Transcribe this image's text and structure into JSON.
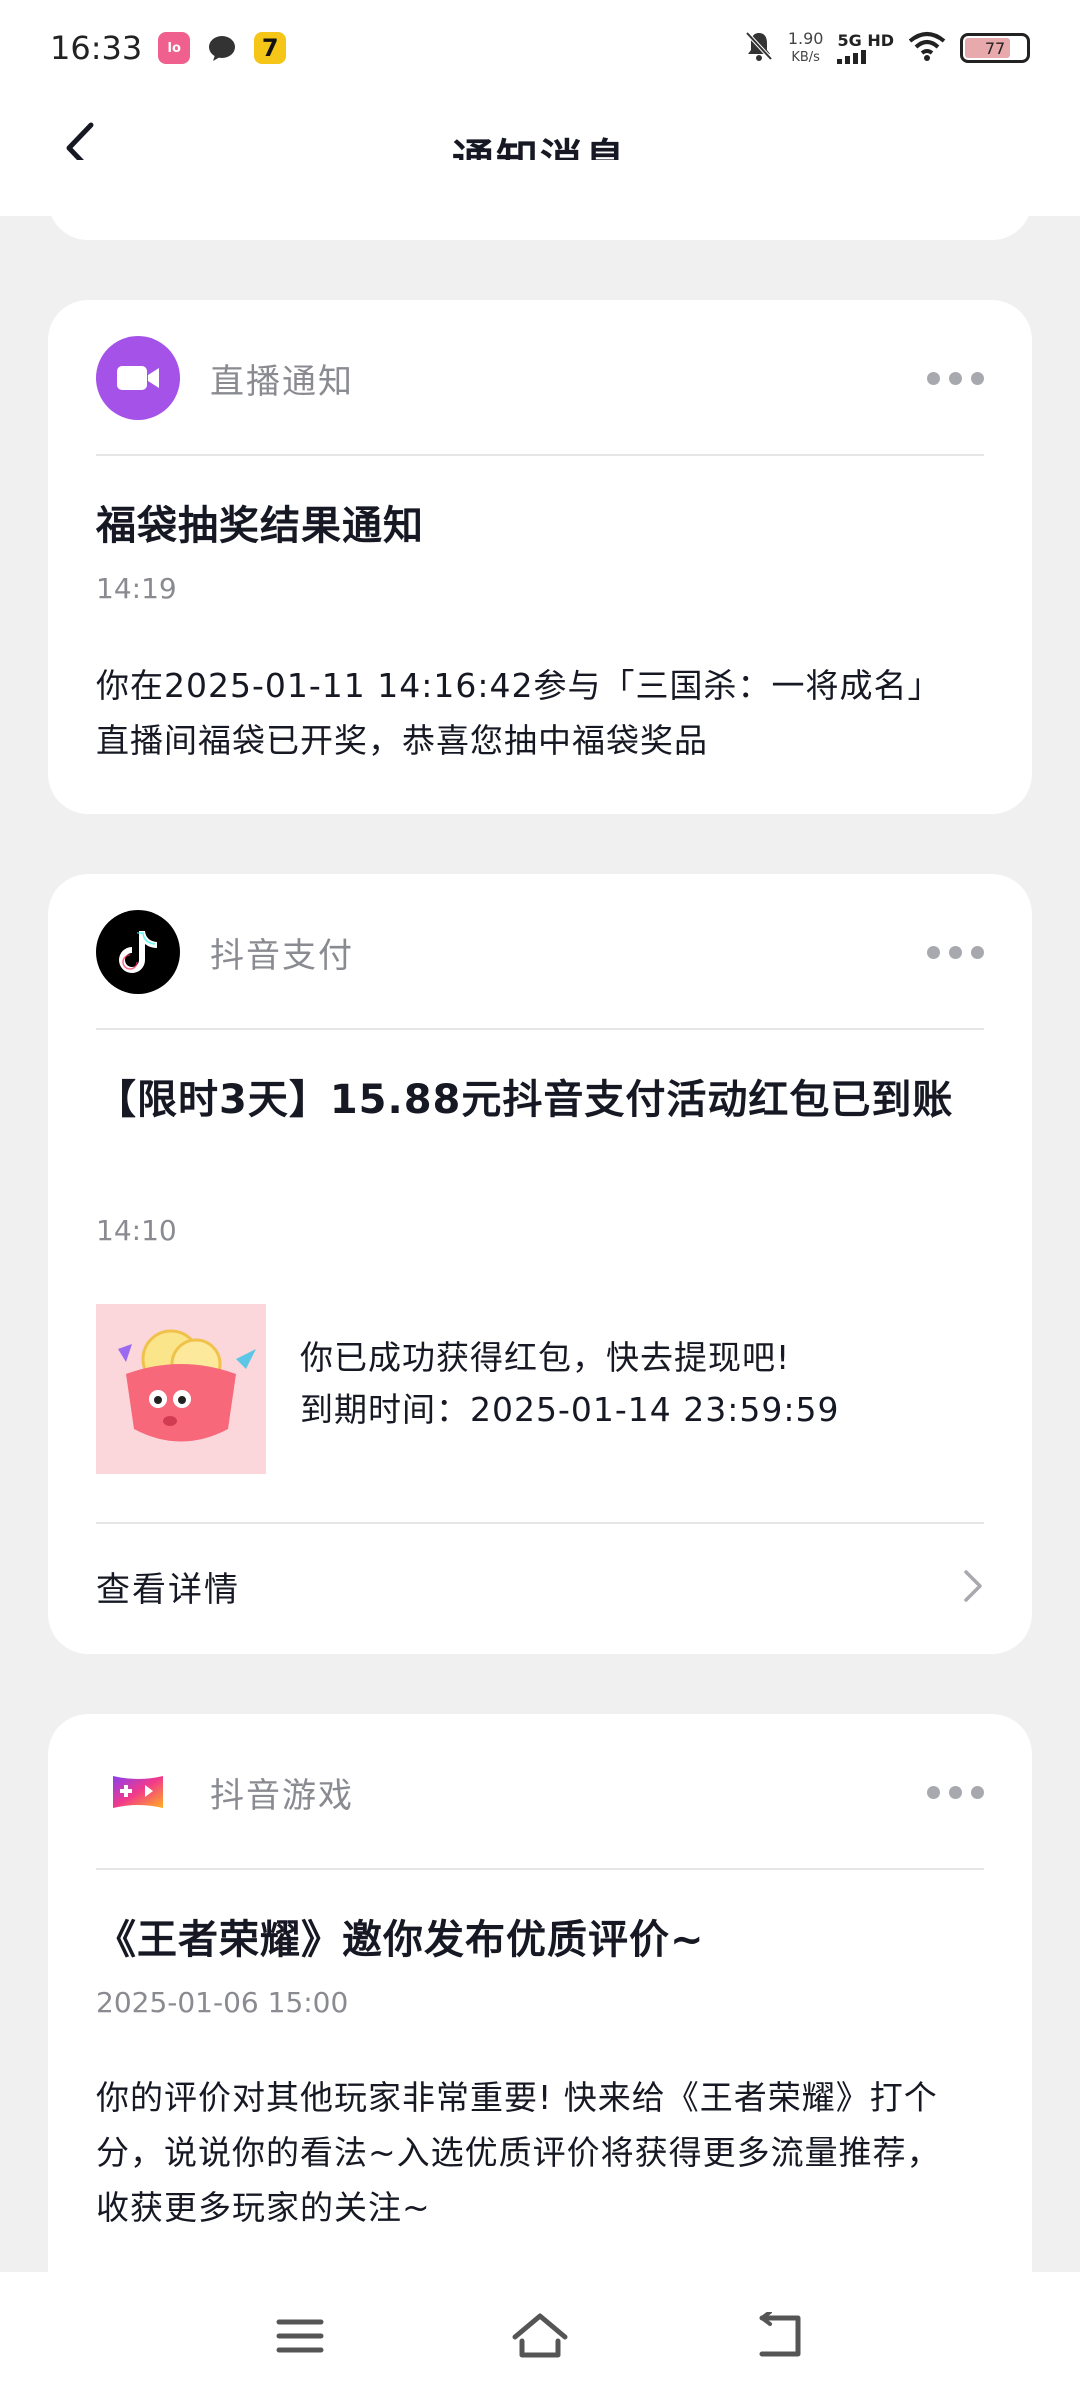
{
  "status_bar": {
    "time": "16:33",
    "apps": [
      "lofter-app-icon",
      "chat-bubble-icon",
      "app-seven-icon"
    ],
    "net_speed_value": "1.90",
    "net_speed_unit": "KB/s",
    "network": "5G HD",
    "battery": "77",
    "battery_level": 0.77
  },
  "header": {
    "title": "通知消息",
    "back_icon": "chevron-left-icon"
  },
  "cards": [
    {
      "source": "直播通知",
      "icon": "live-video-icon",
      "icon_color": "#a552e8",
      "title": "福袋抽奖结果通知",
      "time": "14:19",
      "body": "  你在2025-01-11 14:16:42参与「三国杀：一将成名」 直播间福袋已开奖，恭喜您抽中福袋奖品"
    },
    {
      "source": "抖音支付",
      "icon": "douyin-logo-icon",
      "icon_color": "#000000",
      "title": "【限时3天】15.88元抖音支付活动红包已到账",
      "time": "14:10",
      "body_line1": "你已成功获得红包，快去提现吧!",
      "body_line2": "到期时间：2025-01-14 23:59:59",
      "detail_label": "查看详情"
    },
    {
      "source": "抖音游戏",
      "icon": "game-controller-icon",
      "title": "《王者荣耀》邀你发布优质评价~",
      "time": "2025-01-06 15:00",
      "body": "你的评价对其他玩家非常重要! 快来给《王者荣耀》打个分，说说你的看法~入选优质评价将获得更多流量推荐，收获更多玩家的关注~"
    }
  ],
  "nav": {
    "menu_icon": "menu-icon",
    "home_icon": "home-icon",
    "back_icon": "back-icon"
  }
}
